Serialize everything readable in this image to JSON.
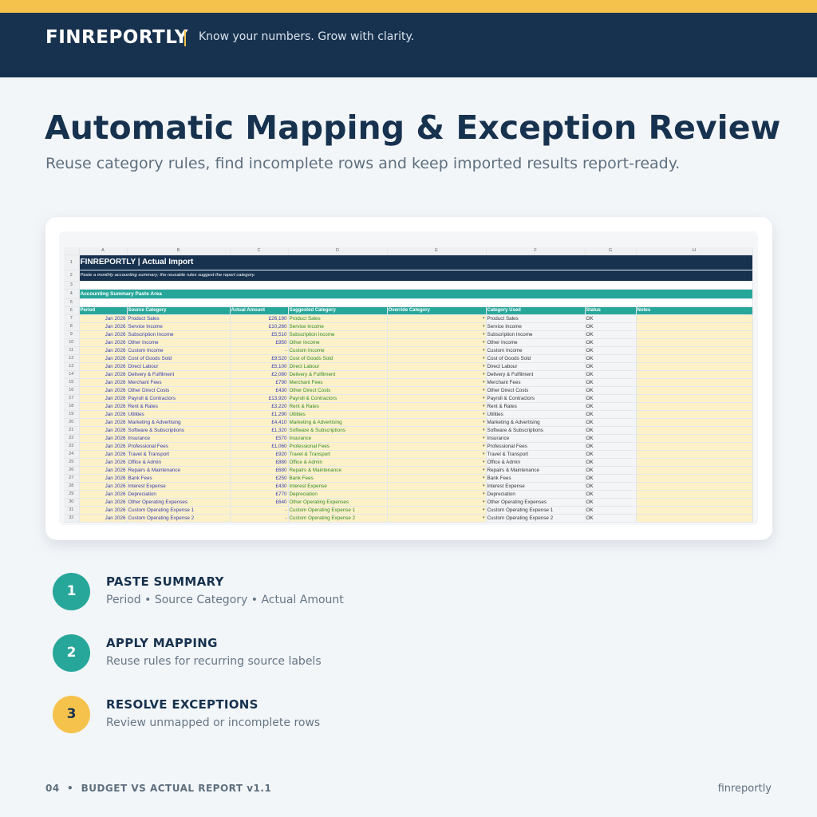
{
  "brand": {
    "name": "FINREPORTLY",
    "tagline": "Know your numbers. Grow with clarity.",
    "colors": {
      "navy": "#17324f",
      "gold": "#f5c24b",
      "teal": "#27a79a"
    }
  },
  "page": {
    "title": "Automatic Mapping & Exception Review",
    "subtitle": "Reuse category rules, find incomplete rows and keep imported results report-ready."
  },
  "sheet": {
    "columns": [
      "A",
      "B",
      "C",
      "D",
      "E",
      "F",
      "G",
      "H"
    ],
    "title": "FINREPORTLY | Actual Import",
    "note": "Paste a monthly accounting summary; the reusable rules suggest the report category.",
    "section": "Accounting Summary Paste Area",
    "headers": [
      "Period",
      "Source Category",
      "Actual Amount",
      "Suggested Category",
      "Override Category",
      "Category Used",
      "Status",
      "Notes"
    ],
    "rows": [
      {
        "period": "Jan 2026",
        "source": "Product Sales",
        "amount": "£26,190",
        "suggested": "Product Sales",
        "used": "Product Sales",
        "status": "OK"
      },
      {
        "period": "Jan 2026",
        "source": "Service Income",
        "amount": "£10,260",
        "suggested": "Service Income",
        "used": "Service Income",
        "status": "OK"
      },
      {
        "period": "Jan 2026",
        "source": "Subscription Income",
        "amount": "£5,510",
        "suggested": "Subscription Income",
        "used": "Subscription Income",
        "status": "OK"
      },
      {
        "period": "Jan 2026",
        "source": "Other Income",
        "amount": "£950",
        "suggested": "Other Income",
        "used": "Other Income",
        "status": "OK"
      },
      {
        "period": "Jan 2026",
        "source": "Custom Income",
        "amount": "-",
        "suggested": "Custom Income",
        "used": "Custom Income",
        "status": "OK"
      },
      {
        "period": "Jan 2026",
        "source": "Cost of Goods Sold",
        "amount": "£9,520",
        "suggested": "Cost of Goods Sold",
        "used": "Cost of Goods Sold",
        "status": "OK"
      },
      {
        "period": "Jan 2026",
        "source": "Direct Labour",
        "amount": "£5,100",
        "suggested": "Direct Labour",
        "used": "Direct Labour",
        "status": "OK"
      },
      {
        "period": "Jan 2026",
        "source": "Delivery & Fulfilment",
        "amount": "£2,080",
        "suggested": "Delivery & Fulfilment",
        "used": "Delivery & Fulfilment",
        "status": "OK"
      },
      {
        "period": "Jan 2026",
        "source": "Merchant Fees",
        "amount": "£790",
        "suggested": "Merchant Fees",
        "used": "Merchant Fees",
        "status": "OK"
      },
      {
        "period": "Jan 2026",
        "source": "Other Direct Costs",
        "amount": "£430",
        "suggested": "Other Direct Costs",
        "used": "Other Direct Costs",
        "status": "OK"
      },
      {
        "period": "Jan 2026",
        "source": "Payroll & Contractors",
        "amount": "£13,920",
        "suggested": "Payroll & Contractors",
        "used": "Payroll & Contractors",
        "status": "OK"
      },
      {
        "period": "Jan 2026",
        "source": "Rent & Rates",
        "amount": "£3,220",
        "suggested": "Rent & Rates",
        "used": "Rent & Rates",
        "status": "OK"
      },
      {
        "period": "Jan 2026",
        "source": "Utilities",
        "amount": "£1,290",
        "suggested": "Utilities",
        "used": "Utilities",
        "status": "OK"
      },
      {
        "period": "Jan 2026",
        "source": "Marketing & Advertising",
        "amount": "£4,410",
        "suggested": "Marketing & Advertising",
        "used": "Marketing & Advertising",
        "status": "OK"
      },
      {
        "period": "Jan 2026",
        "source": "Software & Subscriptions",
        "amount": "£1,320",
        "suggested": "Software & Subscriptions",
        "used": "Software & Subscriptions",
        "status": "OK"
      },
      {
        "period": "Jan 2026",
        "source": "Insurance",
        "amount": "£570",
        "suggested": "Insurance",
        "used": "Insurance",
        "status": "OK"
      },
      {
        "period": "Jan 2026",
        "source": "Professional Fees",
        "amount": "£1,060",
        "suggested": "Professional Fees",
        "used": "Professional Fees",
        "status": "OK"
      },
      {
        "period": "Jan 2026",
        "source": "Travel & Transport",
        "amount": "£920",
        "suggested": "Travel & Transport",
        "used": "Travel & Transport",
        "status": "OK"
      },
      {
        "period": "Jan 2026",
        "source": "Office & Admin",
        "amount": "£880",
        "suggested": "Office & Admin",
        "used": "Office & Admin",
        "status": "OK"
      },
      {
        "period": "Jan 2026",
        "source": "Repairs & Maintenance",
        "amount": "£680",
        "suggested": "Repairs & Maintenance",
        "used": "Repairs & Maintenance",
        "status": "OK"
      },
      {
        "period": "Jan 2026",
        "source": "Bank Fees",
        "amount": "£250",
        "suggested": "Bank Fees",
        "used": "Bank Fees",
        "status": "OK"
      },
      {
        "period": "Jan 2026",
        "source": "Interest Expense",
        "amount": "£430",
        "suggested": "Interest Expense",
        "used": "Interest Expense",
        "status": "OK"
      },
      {
        "period": "Jan 2026",
        "source": "Depreciation",
        "amount": "£770",
        "suggested": "Depreciation",
        "used": "Depreciation",
        "status": "OK"
      },
      {
        "period": "Jan 2026",
        "source": "Other Operating Expenses",
        "amount": "£640",
        "suggested": "Other Operating Expenses",
        "used": "Other Operating Expenses",
        "status": "OK"
      },
      {
        "period": "Jan 2026",
        "source": "Custom Operating Expense 1",
        "amount": "-",
        "suggested": "Custom Operating Expense 1",
        "used": "Custom Operating Expense 1",
        "status": "OK"
      },
      {
        "period": "Jan 2026",
        "source": "Custom Operating Expense 2",
        "amount": "-",
        "suggested": "Custom Operating Expense 2",
        "used": "Custom Operating Expense 2",
        "status": "OK"
      }
    ]
  },
  "steps": [
    {
      "number": "1",
      "title": "PASTE SUMMARY",
      "desc": "Period • Source Category • Actual Amount"
    },
    {
      "number": "2",
      "title": "APPLY MAPPING",
      "desc": "Reuse rules for recurring source labels"
    },
    {
      "number": "3",
      "title": "RESOLVE EXCEPTIONS",
      "desc": "Review unmapped or incomplete rows"
    }
  ],
  "footer": {
    "left": "04  •  BUDGET VS ACTUAL REPORT v1.1",
    "right": "finreportly"
  }
}
